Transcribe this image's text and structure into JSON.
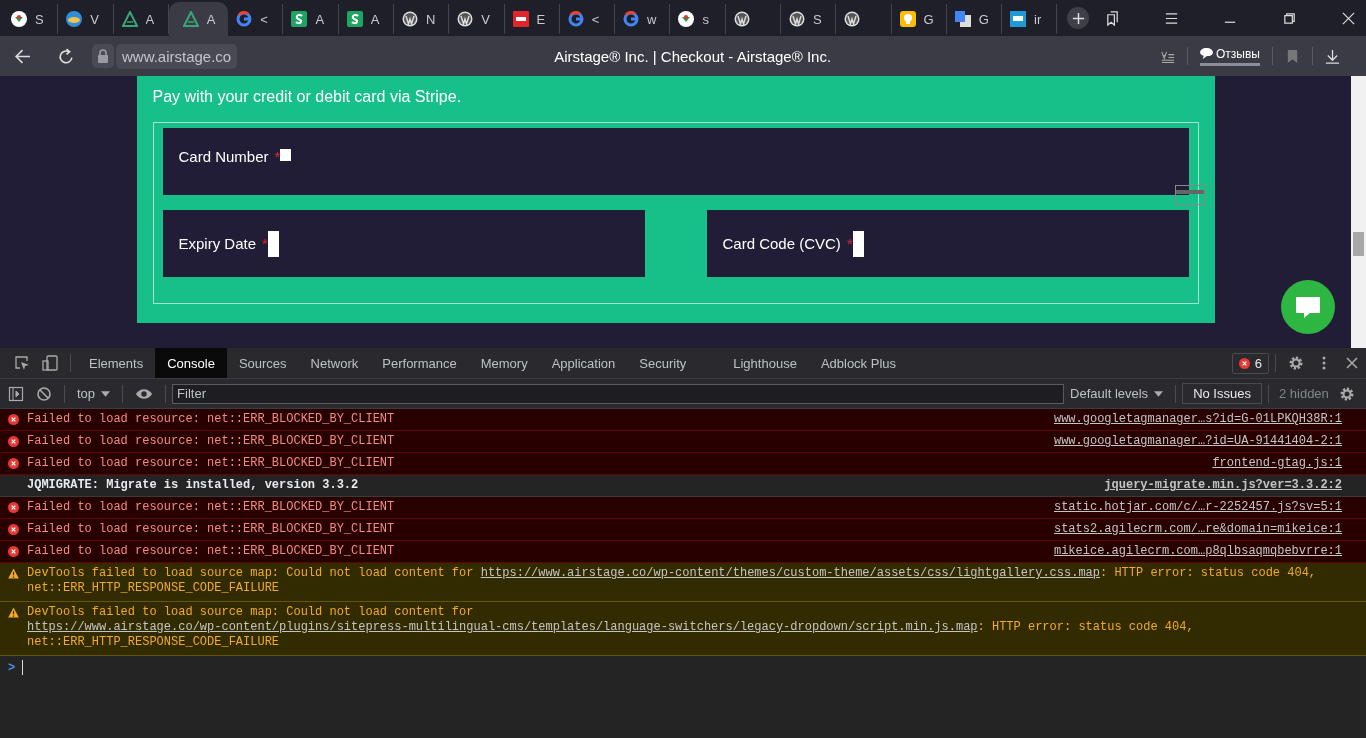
{
  "browser": {
    "tabs": [
      {
        "kind": "rose",
        "label": "S",
        "selected": false
      },
      {
        "kind": "globe",
        "label": "V",
        "selected": false
      },
      {
        "kind": "triangle",
        "label": "A",
        "selected": false
      },
      {
        "kind": "triangle",
        "label": "A",
        "selected": true
      },
      {
        "kind": "google",
        "label": "<",
        "selected": false
      },
      {
        "kind": "sheet",
        "label": "A",
        "selected": false
      },
      {
        "kind": "sheet",
        "label": "A",
        "selected": false
      },
      {
        "kind": "wordpress",
        "label": "N",
        "selected": false
      },
      {
        "kind": "wordpress",
        "label": "V",
        "selected": false
      },
      {
        "kind": "rh",
        "label": "E",
        "selected": false
      },
      {
        "kind": "google",
        "label": "<",
        "selected": false
      },
      {
        "kind": "google",
        "label": "w",
        "selected": false
      },
      {
        "kind": "rose",
        "label": "s",
        "selected": false
      },
      {
        "kind": "wordpress",
        "selected": false
      },
      {
        "kind": "wordpress",
        "label": "S",
        "selected": false
      },
      {
        "kind": "wordpress",
        "selected": false
      },
      {
        "kind": "bulb",
        "label": "G",
        "selected": false
      },
      {
        "kind": "translate",
        "label": "G",
        "selected": false
      },
      {
        "kind": "ibb",
        "label": "ir",
        "selected": false
      }
    ],
    "url": "www.airstage.co",
    "title": "Airstage® Inc. | Checkout - Airstage® Inc.",
    "feedback": "Отзывы"
  },
  "page": {
    "intro": "Pay with your credit or debit card via Stripe.",
    "fields": [
      {
        "kind": "full",
        "label": "Card Number",
        "required_mark": "*"
      },
      {
        "kind": "half",
        "label": "Expiry Date",
        "required_mark": "*"
      },
      {
        "kind": "half",
        "label": "Card Code (CVC)",
        "required_mark": "*"
      }
    ]
  },
  "devtools": {
    "tabs": [
      {
        "label": "Elements",
        "selected": false
      },
      {
        "label": "Console",
        "selected": true
      },
      {
        "label": "Sources",
        "selected": false
      },
      {
        "label": "Network",
        "selected": false
      },
      {
        "label": "Performance",
        "selected": false
      },
      {
        "label": "Memory",
        "selected": false
      },
      {
        "label": "Application",
        "selected": false
      },
      {
        "label": "Security",
        "selected": false
      },
      {
        "label": "Lighthouse",
        "selected": false
      },
      {
        "label": "Adblock Plus",
        "selected": false
      }
    ],
    "error_count": "6",
    "context": "top",
    "filter_placeholder": "Filter",
    "levels": "Default levels",
    "issues": "No Issues",
    "hidden": "2 hidden",
    "messages": [
      {
        "kind": "error",
        "text": "Failed to load resource: net::ERR_BLOCKED_BY_CLIENT",
        "source": "www.googletagmanager…s?id=G-01LPKQH38R:1"
      },
      {
        "kind": "error",
        "text": "Failed to load resource: net::ERR_BLOCKED_BY_CLIENT",
        "source": "www.googletagmanager…?id=UA-91441404-2:1"
      },
      {
        "kind": "error",
        "text": "Failed to load resource: net::ERR_BLOCKED_BY_CLIENT",
        "source": "frontend-gtag.js:1"
      },
      {
        "kind": "info",
        "text": "JQMIGRATE: Migrate is installed, version 3.3.2",
        "source": "jquery-migrate.min.js?ver=3.3.2:2"
      },
      {
        "kind": "error",
        "text": "Failed to load resource: net::ERR_BLOCKED_BY_CLIENT",
        "source": "static.hotjar.com/c/…r-2252457.js?sv=5:1"
      },
      {
        "kind": "error",
        "text": "Failed to load resource: net::ERR_BLOCKED_BY_CLIENT",
        "source": "stats2.agilecrm.com/…re&domain=mikeice:1"
      },
      {
        "kind": "error",
        "text": "Failed to load resource: net::ERR_BLOCKED_BY_CLIENT",
        "source": "mikeice.agilecrm.com…p8qlbsaqmqbebvrre:1"
      },
      {
        "kind": "warning",
        "text": "DevTools failed to load source map: Could not load content for ",
        "link": "https://www.airstage.co/wp-content/themes/custom-theme/assets/css/lightgallery.css.map",
        "rest": ": HTTP error: status code 404, net::ERR_HTTP_RESPONSE_CODE_FAILURE"
      },
      {
        "kind": "warning",
        "text": "DevTools failed to load source map: Could not load content for ",
        "link": "https://www.airstage.co/wp-content/plugins/sitepress-multilingual-cms/templates/language-switchers/legacy-dropdown/script.min.js.map",
        "rest": ": HTTP error: status code 404, net::ERR_HTTP_RESPONSE_CODE_FAILURE"
      }
    ],
    "prompt": ">"
  }
}
